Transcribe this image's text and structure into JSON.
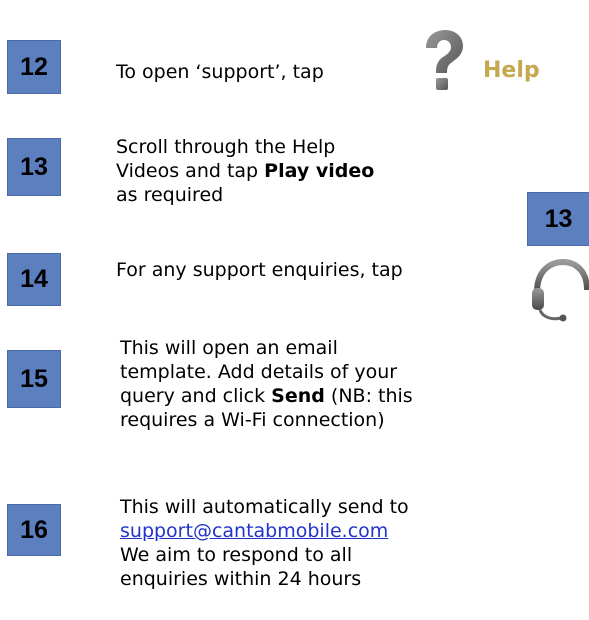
{
  "steps": [
    {
      "number": "12",
      "text": "To open ‘support’, tap"
    },
    {
      "number": "13",
      "line1": "Scroll through the Help",
      "line2_pre": "Videos and tap ",
      "line2_bold": "Play video",
      "line3": "as required"
    },
    {
      "number": "14",
      "text": "For any support enquiries, tap"
    },
    {
      "number": "15",
      "line1": "This will open an email",
      "line2": "template. Add details of your",
      "line3_pre": "query and click ",
      "line3_bold": "Send",
      "line3_post": " (NB: this",
      "line4": "requires a Wi-Fi connection)"
    },
    {
      "number": "16",
      "line1": "This will automatically send to",
      "email": "support@cantabmobile.com",
      "line3": "We aim to respond to all",
      "line4": "enquiries within 24 hours"
    }
  ],
  "side_badge": "13",
  "help_button": {
    "icon": "question-mark-icon",
    "label": "Help"
  },
  "support_icon": "headset-icon",
  "colors": {
    "badge": "#5b7fbf",
    "help_label": "#c6a850",
    "link": "#2233cc"
  }
}
